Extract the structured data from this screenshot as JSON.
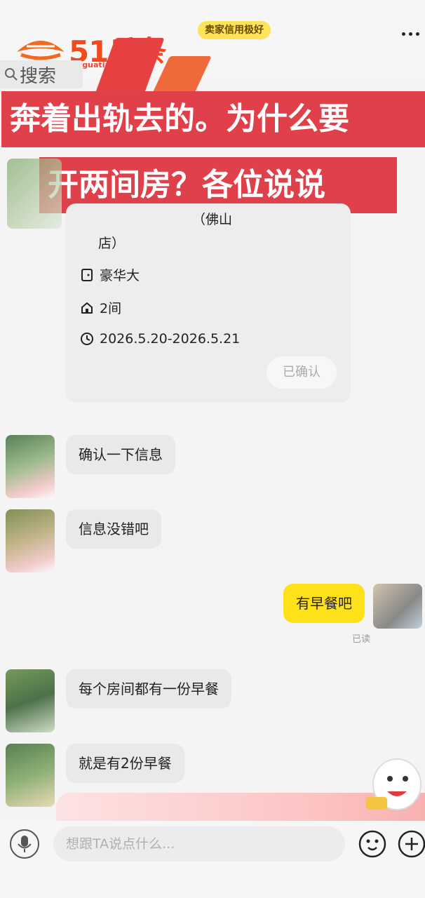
{
  "header": {
    "seller_badge": "卖家信用极好",
    "more_icon": "more-dots-icon"
  },
  "watermark": {
    "logo_text": "51瓜条",
    "logo_sub": "51guatiao.com"
  },
  "search": {
    "label": "搜索",
    "icon": "search-icon"
  },
  "banner": {
    "line1": "奔着出轨去的。为什么要",
    "line2": "开两间房？各位说说"
  },
  "order_card": {
    "hotel_suffix": "（佛山",
    "hotel_line2": "店）",
    "room_type": "豪华大",
    "room_count": "2间",
    "dates": "2026.5.20-2026.5.21",
    "status_button": "已确认"
  },
  "messages": [
    {
      "side": "in",
      "text": "确认一下信息"
    },
    {
      "side": "in",
      "text": "信息没错吧"
    },
    {
      "side": "out",
      "text": "有早餐吧",
      "status": "已读"
    },
    {
      "side": "in",
      "text": "每个房间都有一份早餐"
    },
    {
      "side": "in",
      "text": "就是有2份早餐"
    }
  ],
  "input_bar": {
    "placeholder": "想跟TA说点什么...",
    "mic_icon": "microphone-icon",
    "emoji_icon": "emoji-icon",
    "plus_icon": "plus-icon"
  },
  "colors": {
    "banner_red": "#e0404a",
    "outgoing_bubble": "#ffe11a",
    "badge_yellow": "#fde25a",
    "incoming_bubble": "#e9e9e9"
  }
}
